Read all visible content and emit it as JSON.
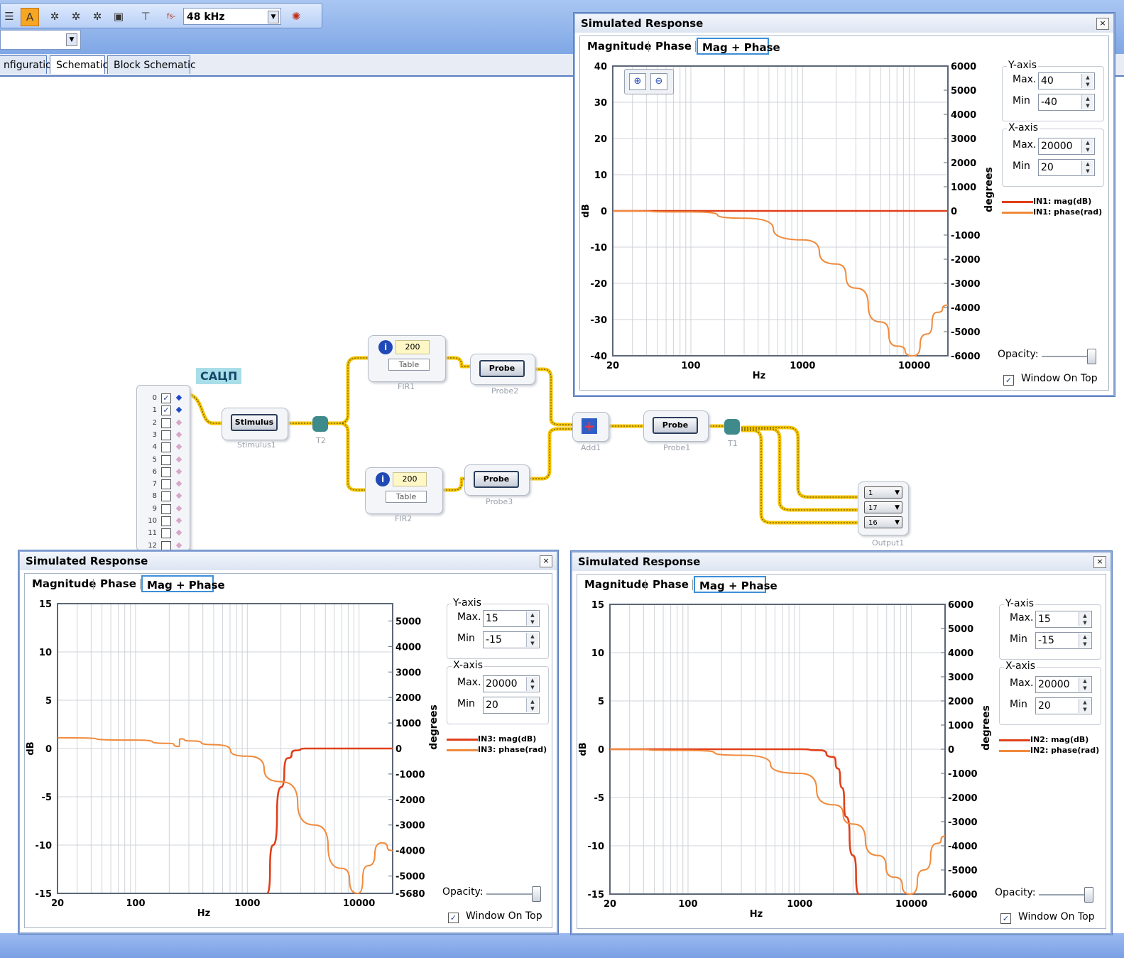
{
  "toolbar": {
    "sample_rate": "48 kHz",
    "fs_label": "fs-",
    "icons": [
      "menu-icon",
      "a-arrows-icon",
      "wand-icon",
      "wand-icon",
      "wand-icon",
      "save-icon",
      "tree-icon",
      "fs-icon",
      "gear-icon"
    ]
  },
  "tabs": [
    "nfiguration",
    "Schematic",
    "Block Schematic"
  ],
  "schematic": {
    "sacp_label": "САЦП",
    "channels": [
      "0",
      "1",
      "2",
      "3",
      "4",
      "5",
      "6",
      "7",
      "8",
      "9",
      "10",
      "11",
      "12"
    ],
    "channels_checked": [
      true,
      true,
      false,
      false,
      false,
      false,
      false,
      false,
      false,
      false,
      false,
      false,
      false
    ],
    "stimulus": {
      "button": "Stimulus",
      "label": "Stimulus1"
    },
    "t2_label": "T2",
    "t1_label": "T1",
    "fir1": {
      "value": "200",
      "table": "Table",
      "label": "FIR1"
    },
    "fir2": {
      "value": "200",
      "table": "Table",
      "label": "FIR2"
    },
    "probe2": {
      "button": "Probe",
      "label": "Probe2"
    },
    "probe3": {
      "button": "Probe",
      "label": "Probe3"
    },
    "probe1": {
      "button": "Probe",
      "label": "Probe1"
    },
    "add1_label": "Add1",
    "output": {
      "label": "Output1",
      "channels": [
        "1",
        "17",
        "16"
      ]
    }
  },
  "windows": [
    {
      "id": "top",
      "title": "Simulated Response",
      "tabs": [
        "Magnitude",
        "Phase",
        "Mag + Phase"
      ],
      "selected_tab": "Mag + Phase",
      "y_axis": {
        "max": "40",
        "min": "-40"
      },
      "x_axis": {
        "max": "20000",
        "min": "20"
      },
      "y_ticks": [
        "40",
        "30",
        "20",
        "10",
        "0",
        "-10",
        "-20",
        "-30",
        "-40"
      ],
      "y2_ticks": [
        "6000",
        "5000",
        "4000",
        "3000",
        "2000",
        "1000",
        "0",
        "-1000",
        "-2000",
        "-3000",
        "-4000",
        "-5000",
        "-6000"
      ],
      "x_ticks": [
        "20",
        "100",
        "1000",
        "10000"
      ],
      "ylabel": "dB",
      "xlabel": "Hz",
      "y2label": "degrees",
      "legend": [
        "IN1: mag(dB)",
        "IN1: phase(rad)"
      ],
      "group_y": "Y-axis",
      "group_x": "X-axis",
      "max_label": "Max.",
      "min_label": "Min",
      "opacity_label": "Opacity:",
      "window_on_top": "Window On Top"
    },
    {
      "id": "left",
      "title": "Simulated Response",
      "tabs": [
        "Magnitude",
        "Phase",
        "Mag + Phase"
      ],
      "selected_tab": "Mag + Phase",
      "y_axis": {
        "max": "15",
        "min": "-15"
      },
      "x_axis": {
        "max": "20000",
        "min": "20"
      },
      "y_ticks": [
        "15",
        "10",
        "5",
        "0",
        "-5",
        "-10",
        "-15"
      ],
      "y2_ticks": [
        "5000",
        "4000",
        "3000",
        "2000",
        "1000",
        "0",
        "-1000",
        "-2000",
        "-3000",
        "-4000",
        "-5000",
        "-5680"
      ],
      "x_ticks": [
        "20",
        "100",
        "1000",
        "10000"
      ],
      "ylabel": "dB",
      "xlabel": "Hz",
      "y2label": "degrees",
      "legend": [
        "IN3: mag(dB)",
        "IN3: phase(rad)"
      ],
      "group_y": "Y-axis",
      "group_x": "X-axis",
      "max_label": "Max.",
      "min_label": "Min",
      "opacity_label": "Opacity:",
      "window_on_top": "Window On Top"
    },
    {
      "id": "right",
      "title": "Simulated Response",
      "tabs": [
        "Magnitude",
        "Phase",
        "Mag + Phase"
      ],
      "selected_tab": "Mag + Phase",
      "y_axis": {
        "max": "15",
        "min": "-15"
      },
      "x_axis": {
        "max": "20000",
        "min": "20"
      },
      "y_ticks": [
        "15",
        "10",
        "5",
        "0",
        "-5",
        "-10",
        "-15"
      ],
      "y2_ticks": [
        "6000",
        "5000",
        "4000",
        "3000",
        "2000",
        "1000",
        "0",
        "-1000",
        "-2000",
        "-3000",
        "-4000",
        "-5000",
        "-6000"
      ],
      "x_ticks": [
        "20",
        "100",
        "1000",
        "10000"
      ],
      "ylabel": "dB",
      "xlabel": "Hz",
      "y2label": "degrees",
      "legend": [
        "IN2: mag(dB)",
        "IN2: phase(rad)"
      ],
      "group_y": "Y-axis",
      "group_x": "X-axis",
      "max_label": "Max.",
      "min_label": "Min",
      "opacity_label": "Opacity:",
      "window_on_top": "Window On Top"
    }
  ],
  "colors": {
    "mag": "#e0401a",
    "phase": "#f08a3c",
    "wire": "#f5c400",
    "wire_dots": "#6a5a00",
    "grid": "#cfd3d8",
    "accent": "#3b8fd8"
  },
  "chart_data": [
    {
      "type": "line",
      "title": "",
      "xlabel": "Hz",
      "ylabel": "dB",
      "y2label": "degrees",
      "xscale": "log",
      "xlim": [
        20,
        20000
      ],
      "ylim": [
        -40,
        40
      ],
      "y2lim": [
        -6000,
        6000
      ],
      "series": [
        {
          "name": "IN1: mag(dB)",
          "axis": "left",
          "x": [
            20,
            100,
            1000,
            10000,
            20000
          ],
          "y": [
            0,
            0,
            0,
            0,
            0
          ]
        },
        {
          "name": "IN1: phase(rad)",
          "axis": "right",
          "x": [
            20,
            100,
            300,
            1000,
            2000,
            3000,
            5000,
            7000,
            9800,
            13000,
            16000,
            20000
          ],
          "y": [
            0,
            -40,
            -300,
            -1200,
            -2200,
            -3200,
            -4600,
            -5600,
            -6000,
            -5100,
            -4200,
            -3900
          ]
        }
      ]
    },
    {
      "type": "line",
      "title": "",
      "xlabel": "Hz",
      "ylabel": "dB",
      "y2label": "degrees",
      "xscale": "log",
      "xlim": [
        20,
        20000
      ],
      "ylim": [
        -15,
        15
      ],
      "y2lim": [
        -5680,
        5680
      ],
      "series": [
        {
          "name": "IN3: mag(dB)",
          "axis": "left",
          "x": [
            1500,
            1700,
            2000,
            2300,
            2700,
            3300,
            5000,
            10000,
            20000
          ],
          "y": [
            -15,
            -10,
            -4,
            -1,
            -0.2,
            0,
            0,
            0,
            0
          ]
        },
        {
          "name": "IN3: phase(rad)",
          "axis": "right",
          "x": [
            20,
            100,
            200,
            245,
            250,
            300,
            500,
            1000,
            2000,
            4000,
            7000,
            9700,
            12000,
            16000,
            20000
          ],
          "y": [
            420,
            330,
            200,
            80,
            380,
            300,
            150,
            -300,
            -1300,
            -3000,
            -4700,
            -5680,
            -4600,
            -3700,
            -4000
          ]
        }
      ]
    },
    {
      "type": "line",
      "title": "",
      "xlabel": "Hz",
      "ylabel": "dB",
      "y2label": "degrees",
      "xscale": "log",
      "xlim": [
        20,
        20000
      ],
      "ylim": [
        -15,
        15
      ],
      "y2lim": [
        -6000,
        6000
      ],
      "series": [
        {
          "name": "IN2: mag(dB)",
          "axis": "left",
          "x": [
            20,
            1000,
            1500,
            2000,
            2200,
            2400,
            2600,
            3000,
            3400
          ],
          "y": [
            0,
            0,
            -0.1,
            -0.8,
            -2,
            -4,
            -7,
            -11,
            -15
          ]
        },
        {
          "name": "IN2: phase(rad)",
          "axis": "right",
          "x": [
            20,
            100,
            300,
            1000,
            2000,
            3000,
            5000,
            7000,
            9800,
            13000,
            17000,
            20000
          ],
          "y": [
            0,
            -50,
            -250,
            -1000,
            -2300,
            -3100,
            -4400,
            -5300,
            -6000,
            -5000,
            -3900,
            -3600
          ]
        }
      ]
    }
  ]
}
